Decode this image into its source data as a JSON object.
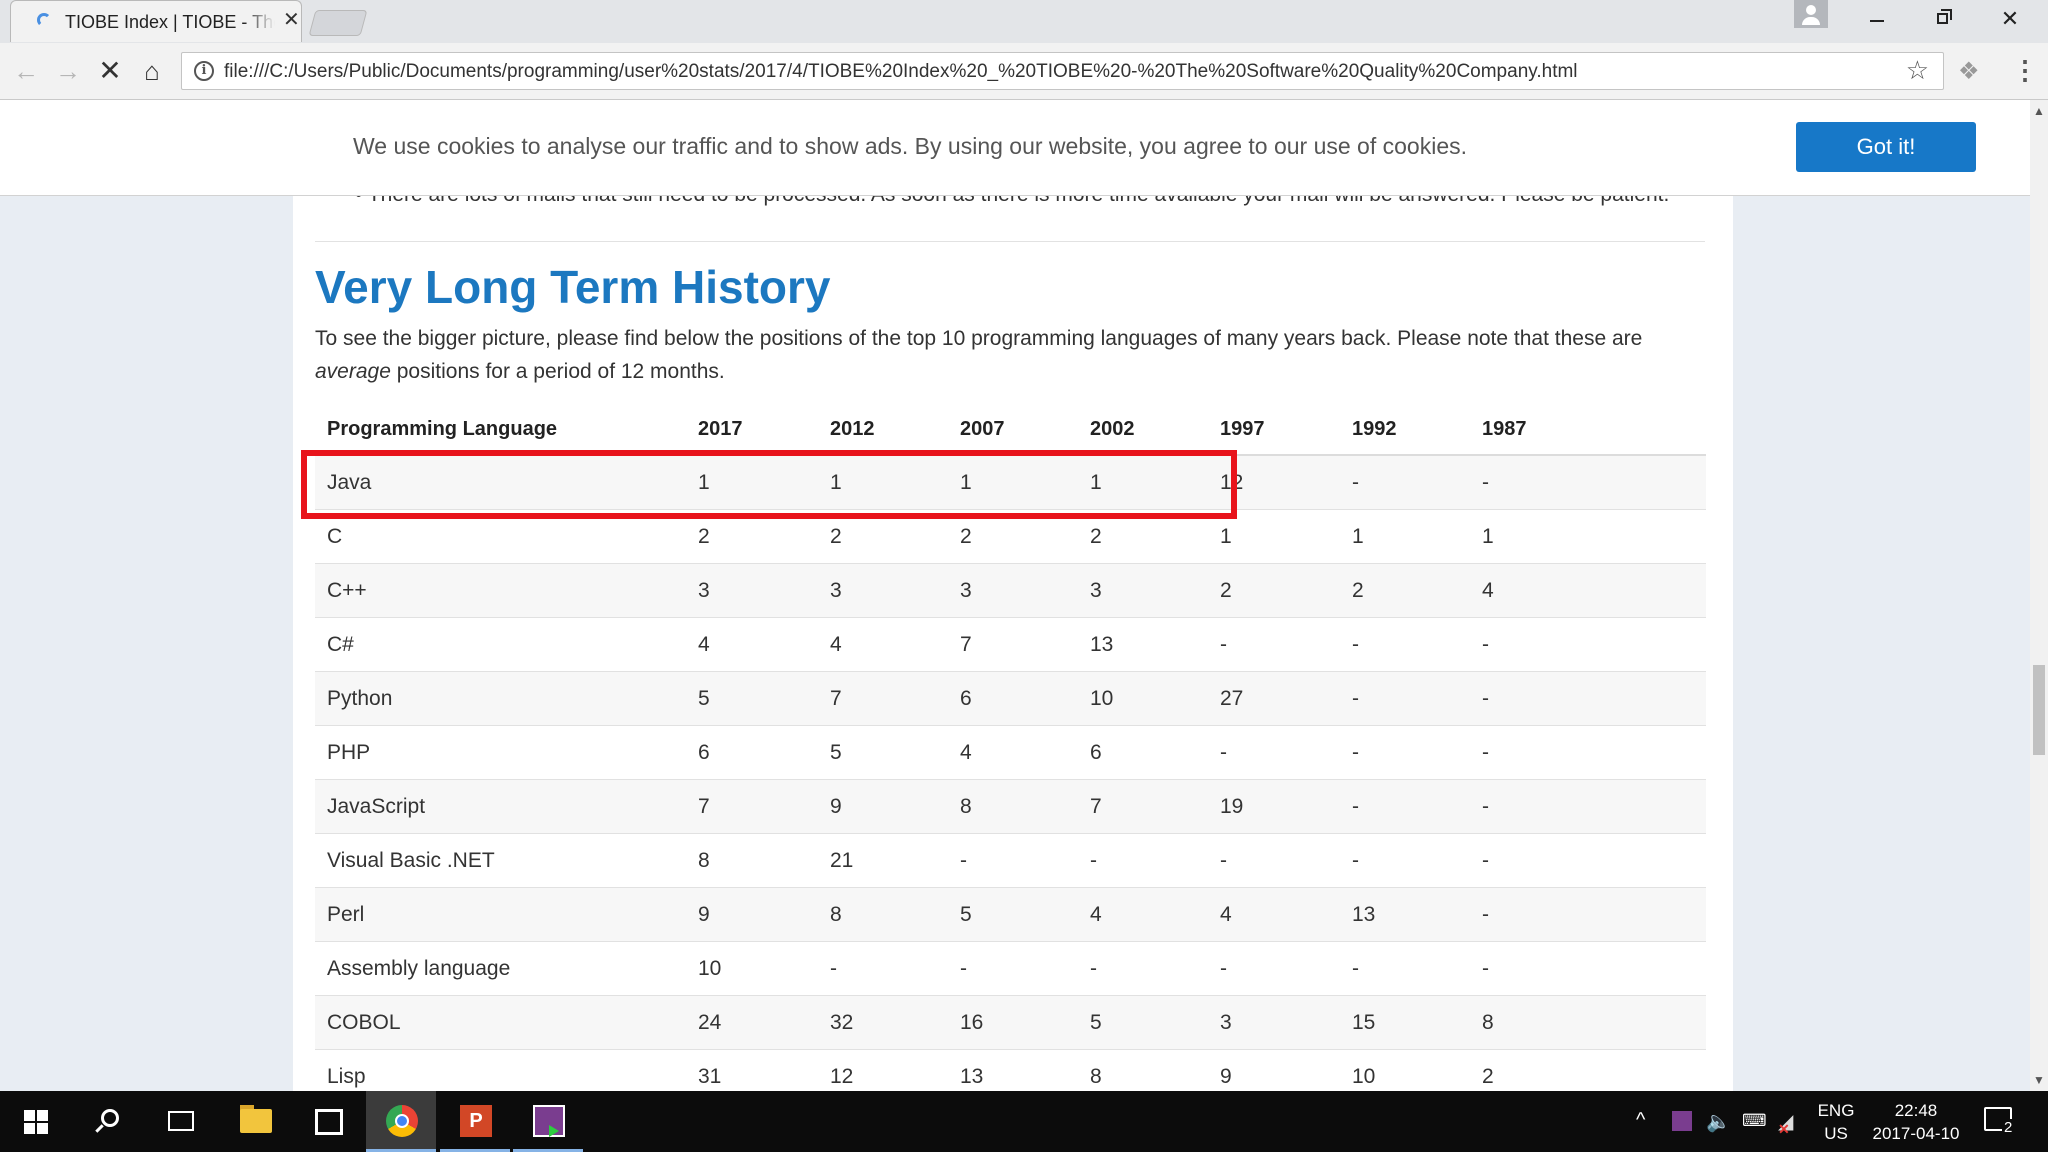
{
  "browser": {
    "tab_title": "TIOBE Index | TIOBE - The Software Quality Company",
    "url": "file:///C:/Users/Public/Documents/programming/user%20stats/2017/4/TIOBE%20Index%20_%20TIOBE%20-%20The%20Software%20Quality%20Company.html"
  },
  "cookie": {
    "text": "We use cookies to analyse our traffic and to show ads. By using our website, you agree to our use of cookies.",
    "button_label": "Got it!"
  },
  "page": {
    "prev_bullet": "There are lots of mails that still need to be processed. As soon as there is more time available your mail will be answered. Please be patient.",
    "heading": "Very Long Term History",
    "intro_before": "To see the bigger picture, please find below the positions of the top 10 programming languages of many years back. Please note that these are",
    "intro_em": "average",
    "intro_after": "positions for a period of 12 months."
  },
  "table": {
    "headers": [
      "Programming Language",
      "2017",
      "2012",
      "2007",
      "2002",
      "1997",
      "1992",
      "1987"
    ],
    "rows": [
      [
        "Java",
        "1",
        "1",
        "1",
        "1",
        "12",
        "-",
        "-"
      ],
      [
        "C",
        "2",
        "2",
        "2",
        "2",
        "1",
        "1",
        "1"
      ],
      [
        "C++",
        "3",
        "3",
        "3",
        "3",
        "2",
        "2",
        "4"
      ],
      [
        "C#",
        "4",
        "4",
        "7",
        "13",
        "-",
        "-",
        "-"
      ],
      [
        "Python",
        "5",
        "7",
        "6",
        "10",
        "27",
        "-",
        "-"
      ],
      [
        "PHP",
        "6",
        "5",
        "4",
        "6",
        "-",
        "-",
        "-"
      ],
      [
        "JavaScript",
        "7",
        "9",
        "8",
        "7",
        "19",
        "-",
        "-"
      ],
      [
        "Visual Basic .NET",
        "8",
        "21",
        "-",
        "-",
        "-",
        "-",
        "-"
      ],
      [
        "Perl",
        "9",
        "8",
        "5",
        "4",
        "4",
        "13",
        "-"
      ],
      [
        "Assembly language",
        "10",
        "-",
        "-",
        "-",
        "-",
        "-",
        "-"
      ],
      [
        "COBOL",
        "24",
        "32",
        "16",
        "5",
        "3",
        "15",
        "8"
      ],
      [
        "Lisp",
        "31",
        "12",
        "13",
        "8",
        "9",
        "10",
        "2"
      ]
    ],
    "highlight_color": "#e8141c"
  },
  "taskbar": {
    "lang_line1": "ENG",
    "lang_line2": "US",
    "time": "22:48",
    "date": "2017-04-10",
    "notification_count": "2"
  },
  "colors": {
    "heading": "#1c78c0",
    "got_it_button": "#1778c8",
    "page_background": "#e8edf3"
  }
}
